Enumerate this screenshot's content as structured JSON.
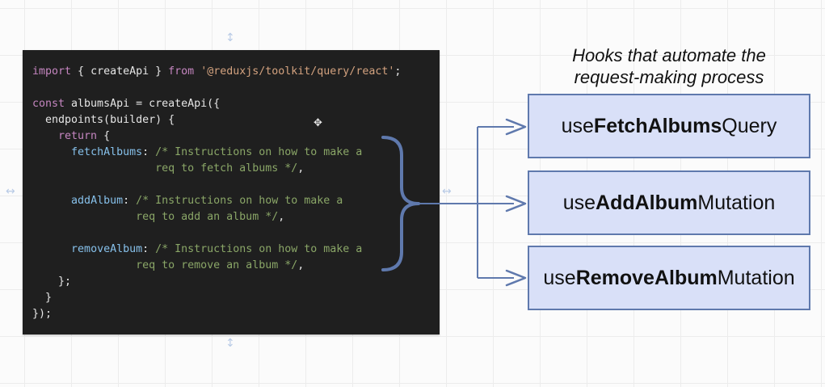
{
  "code": {
    "line1": {
      "kw1": "import",
      "p1": " { createApi } ",
      "kw2": "from",
      "p2": " ",
      "str": "'@reduxjs/toolkit/query/react'",
      "p3": ";"
    },
    "line3": {
      "kw": "const",
      "p1": " albumsApi = createApi({"
    },
    "line4": {
      "p1": "  endpoints(builder) {"
    },
    "line5": {
      "kw": "return",
      "indent": "    ",
      "p1": " {"
    },
    "line6": {
      "indent": "      ",
      "prop": "fetchAlbums",
      "p1": ": ",
      "cm": "/* Instructions on how to make a"
    },
    "line7": {
      "indent": "                   ",
      "cm": "req to fetch albums */",
      "p1": ","
    },
    "line9": {
      "indent": "      ",
      "prop": "addAlbum",
      "p1": ": ",
      "cm": "/* Instructions on how to make a"
    },
    "line10": {
      "indent": "                ",
      "cm": "req to add an album */",
      "p1": ","
    },
    "line12": {
      "indent": "      ",
      "prop": "removeAlbum",
      "p1": ": ",
      "cm": "/* Instructions on how to make a"
    },
    "line13": {
      "indent": "                ",
      "cm": "req to remove an album */",
      "p1": ","
    },
    "line14": {
      "p1": "    };"
    },
    "line15": {
      "p1": "  }"
    },
    "line16": {
      "p1": "});"
    }
  },
  "caption": {
    "line1": "Hooks that automate the",
    "line2": "request-making process"
  },
  "hooks": [
    {
      "prefix": "use",
      "bold": "FetchAlbums",
      "suffix": "Query"
    },
    {
      "prefix": "use",
      "bold": "AddAlbum",
      "suffix": "Mutation"
    },
    {
      "prefix": "use",
      "bold": "RemoveAlbum",
      "suffix": "Mutation"
    }
  ],
  "icons": {
    "bracket": "curly-bracket-icon",
    "arrow": "arrow-right-icon",
    "crosshair": "crosshair-icon",
    "handle": "resize-handle-icon"
  },
  "colors": {
    "code_background": "#1f1f1f",
    "keyword": "#c586c0",
    "string": "#d3a27f",
    "property": "#86c0ea",
    "comment": "#8aa667",
    "box_fill": "#d9e0f8",
    "box_border": "#5f79ad",
    "connector": "#5f79ad"
  }
}
